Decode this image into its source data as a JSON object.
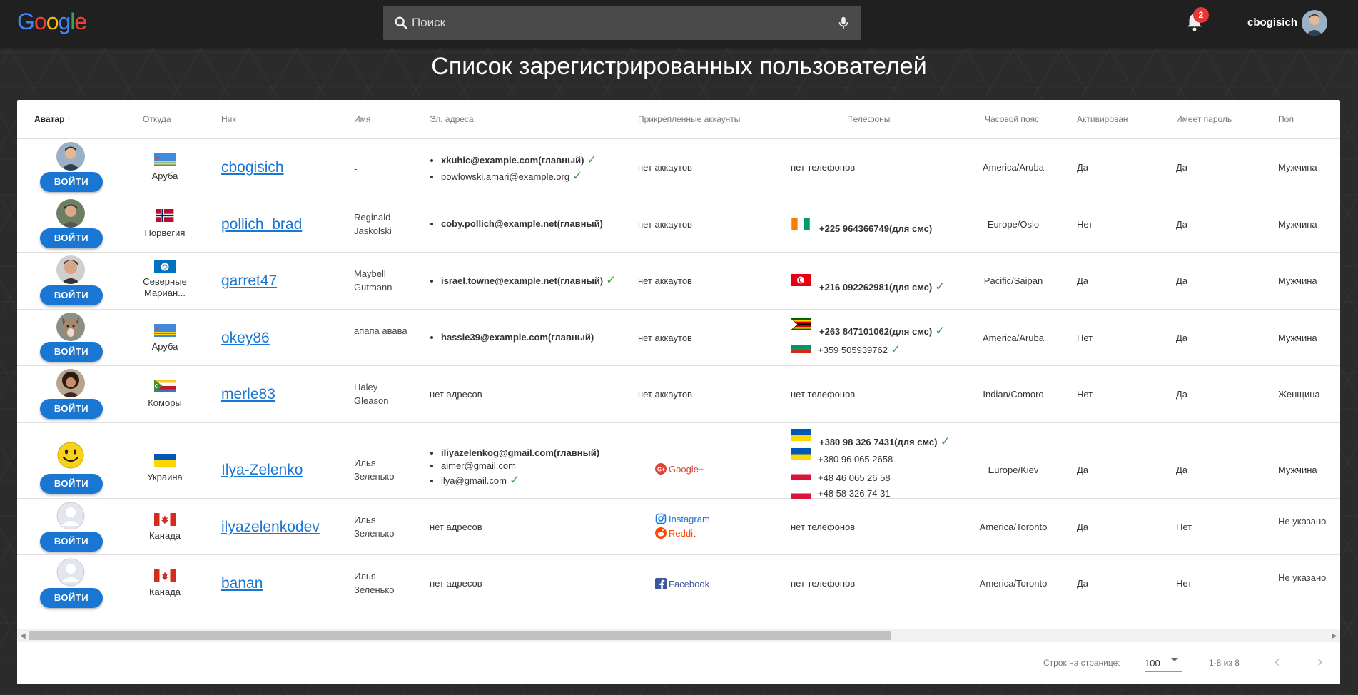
{
  "header": {
    "logo": [
      "G",
      "o",
      "o",
      "g",
      "l",
      "e"
    ],
    "logo_colors": [
      "#4285F4",
      "#EA4335",
      "#FBBC05",
      "#4285F4",
      "#34A853",
      "#EA4335"
    ],
    "search_placeholder": "Поиск",
    "notifications_count": "2",
    "username": "cbogisich"
  },
  "page_title": "Список зарегистрированных пользователей",
  "table": {
    "columns": {
      "avatar": "Аватар",
      "sort_arrow": "↑",
      "from": "Откуда",
      "nick": "Ник",
      "name": "Имя",
      "emails": "Эл. адреса",
      "accounts": "Прикрепленные аккаунты",
      "phones": "Телефоны",
      "timezone": "Часовой пояс",
      "activated": "Активирован",
      "has_password": "Имеет пароль",
      "gender": "Пол"
    },
    "login_label": "ВОЙТИ",
    "rows": [
      {
        "country": "Аруба",
        "nick": "cbogisich",
        "name": "-",
        "emails": [
          {
            "text": "xkuhic@example.com(главный)",
            "check": "✓"
          },
          {
            "text": "powlowski.amari@example.org",
            "check": "✓"
          }
        ],
        "accounts": "нет аккаутов",
        "phones_text": "нет телефонов",
        "timezone": "America/Aruba",
        "activated": "Да",
        "has_password": "Да",
        "gender": "Мужчина"
      },
      {
        "country": "Норвегия",
        "nick": "pollich_brad",
        "name": "Reginald Jaskolski",
        "emails": [
          {
            "text": "coby.pollich@example.net(главный)"
          }
        ],
        "accounts": "нет аккаутов",
        "phones": [
          {
            "text": "+225 964366749(для смс)"
          }
        ],
        "timezone": "Europe/Oslo",
        "activated": "Нет",
        "has_password": "Да",
        "gender": "Мужчина"
      },
      {
        "country": "Северные Мариан...",
        "nick": "garret47",
        "name": "Maybell Gutmann",
        "emails": [
          {
            "text": "israel.towne@example.net(главный)",
            "check": "✓"
          }
        ],
        "accounts": "нет аккаутов",
        "phones": [
          {
            "text": "+216 092262981(для смс)",
            "check": "✓"
          }
        ],
        "timezone": "Pacific/Saipan",
        "activated": "Да",
        "has_password": "Да",
        "gender": "Мужчина"
      },
      {
        "country": "Аруба",
        "nick": "okey86",
        "name": "апапа авава",
        "emails": [
          {
            "text": "hassie39@example.com(главный)"
          }
        ],
        "accounts": "нет аккаутов",
        "phones": [
          {
            "text": "+263 847101062(для смс)",
            "check": "✓"
          },
          {
            "text": "+359 505939762",
            "check": "✓"
          }
        ],
        "timezone": "America/Aruba",
        "activated": "Нет",
        "has_password": "Да",
        "gender": "Мужчина"
      },
      {
        "country": "Коморы",
        "nick": "merle83",
        "name": "Haley Gleason",
        "emails_text": "нет адресов",
        "accounts": "нет аккаутов",
        "phones_text": "нет телефонов",
        "timezone": "Indian/Comoro",
        "activated": "Нет",
        "has_password": "Да",
        "gender": "Женщина"
      },
      {
        "country": "Украина",
        "nick": "Ilya-Zelenko",
        "name": "Илья Зеленько",
        "emails": [
          {
            "text": "iliyazelenkog@gmail.com(главный)"
          },
          {
            "text": "aimer@gmail.com"
          },
          {
            "text": "ilya@gmail.com",
            "check": "✓"
          }
        ],
        "accounts_list": [
          "Google+"
        ],
        "phones": [
          {
            "text": "+380 98 326 7431(для смс)",
            "check": "✓"
          },
          {
            "text": "+380 96 065 2658"
          },
          {
            "text": "+48 46 065 26 58"
          },
          {
            "text": "+48 58 326 74 31"
          }
        ],
        "timezone": "Europe/Kiev",
        "activated": "Да",
        "has_password": "Да",
        "gender": "Мужчина"
      },
      {
        "country": "Канада",
        "nick": "ilyazelenkodev",
        "name": "Илья Зеленько",
        "emails_text": "нет адресов",
        "accounts_list": [
          "Instagram",
          "Reddit"
        ],
        "phones_text": "нет телефонов",
        "timezone": "America/Toronto",
        "activated": "Да",
        "has_password": "Нет",
        "gender": "Не указано"
      },
      {
        "country": "Канада",
        "nick": "banan",
        "name": "Илья Зеленько",
        "emails_text": "нет адресов",
        "accounts_list": [
          "Facebook"
        ],
        "phones_text": "нет телефонов",
        "timezone": "America/Toronto",
        "activated": "Да",
        "has_password": "Нет",
        "gender": "Не указано"
      }
    ]
  },
  "footer": {
    "rows_per_page_label": "Строк на странице:",
    "rows_per_page_value": "100",
    "range": "1-8 из 8",
    "prev": "‹",
    "next": "›"
  },
  "colors": {
    "accent": "#1976d2",
    "check": "#43a047",
    "google_plus": "#db4437",
    "reddit": "#ff4500",
    "facebook": "#3b5998",
    "instagram": "#1976d2"
  }
}
